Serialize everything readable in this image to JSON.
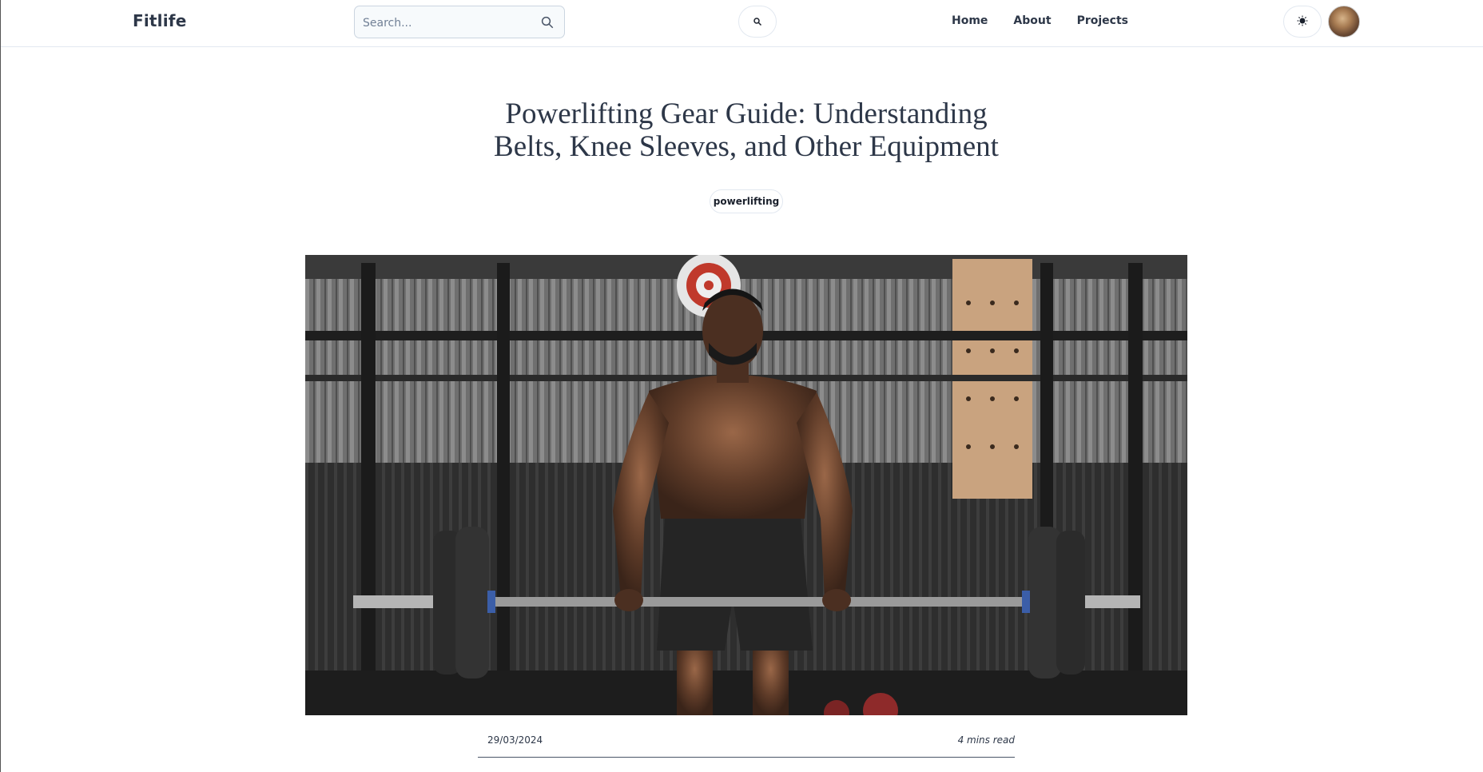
{
  "header": {
    "brand": "Fitlife",
    "search_placeholder": "Search...",
    "nav_links": [
      "Home",
      "About",
      "Projects"
    ]
  },
  "post": {
    "title_line1": "Powerlifting Gear Guide: Understanding",
    "title_line2": "Belts, Knee Sleeves, and Other Equipment",
    "tag": "powerlifting",
    "date": "29/03/2024",
    "read_time": "4 mins read"
  },
  "icons": {
    "search": "magnifier-icon",
    "theme": "sun-icon",
    "avatar": "user-avatar"
  },
  "colors": {
    "text": "#2d3748",
    "border": "#e2e8f0"
  }
}
